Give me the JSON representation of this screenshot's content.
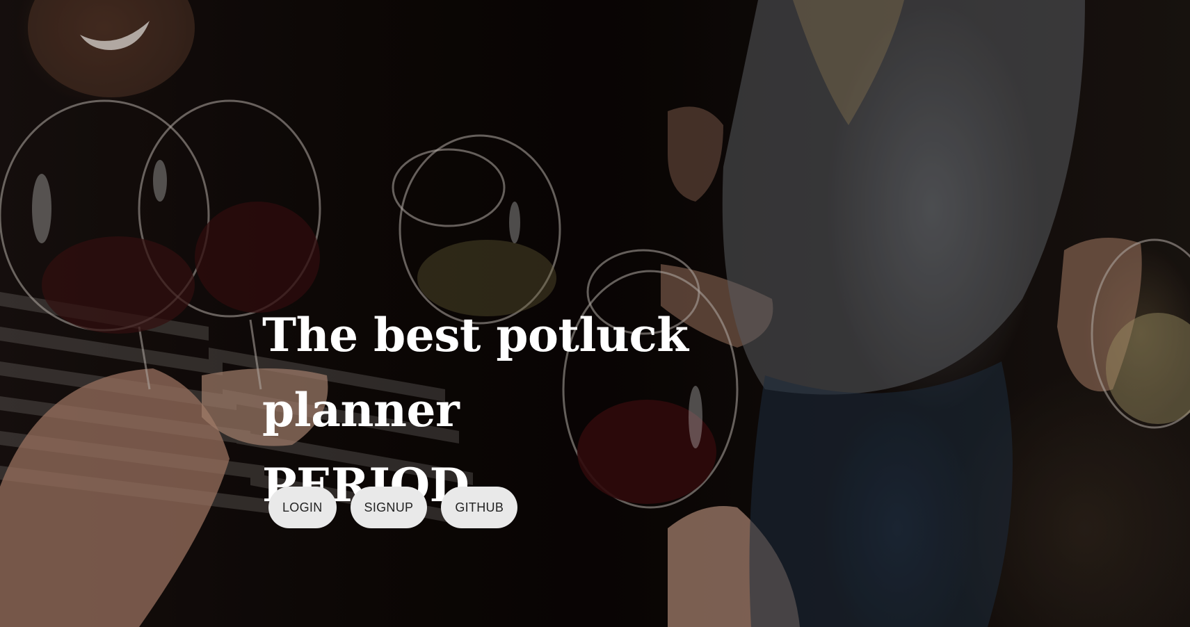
{
  "hero": {
    "headline_line1": "The best potluck planner",
    "headline_line2": "PERIOD."
  },
  "buttons": {
    "login": "LOGIN",
    "signup": "SIGNUP",
    "github": "GITHUB"
  },
  "colors": {
    "headline": "#ffffff",
    "button_bg": "#e9e9e9",
    "button_text": "#222222",
    "background": "#0d0806"
  },
  "background_image": "friends-toasting-wine-glasses"
}
